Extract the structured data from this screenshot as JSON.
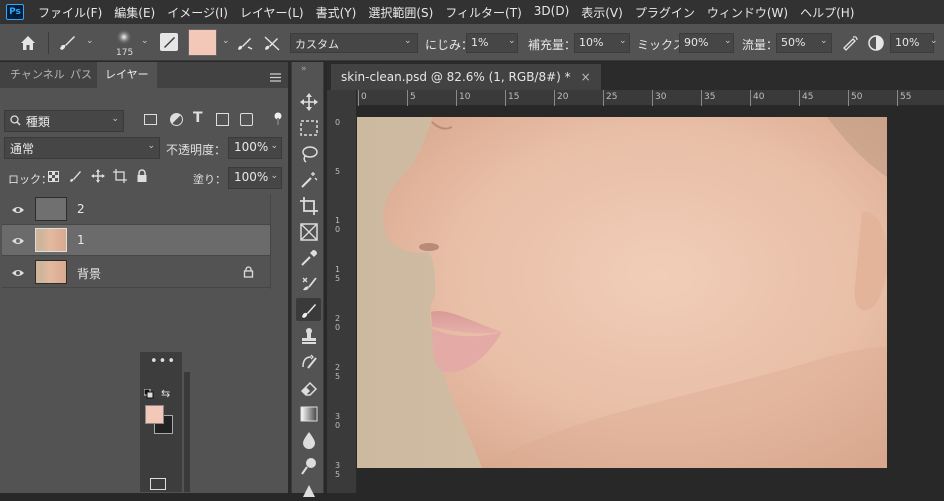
{
  "app": {
    "logo": "Ps"
  },
  "menu": [
    "ファイル(F)",
    "編集(E)",
    "イメージ(I)",
    "レイヤー(L)",
    "書式(Y)",
    "選択範囲(S)",
    "フィルター(T)",
    "3D(D)",
    "表示(V)",
    "プラグイン",
    "ウィンドウ(W)",
    "ヘルプ(H)"
  ],
  "options": {
    "brush_size": "175",
    "mode": "カスタム",
    "wet_label": "にじみ：",
    "wet_value": "1%",
    "load_label": "補充量：",
    "load_value": "10%",
    "mix_label": "ミックス：",
    "mix_value": "90%",
    "flow_label": "流量：",
    "flow_value": "50%",
    "extra_value": "10%",
    "color": "#f3c8b8"
  },
  "panel": {
    "tabs": [
      "チャンネル",
      "パス",
      "レイヤー"
    ],
    "active_tab": "レイヤー",
    "filter_kind": "種類",
    "blend_mode": "通常",
    "opacity_label": "不透明度：",
    "opacity_value": "100%",
    "lock_label": "ロック：",
    "fill_label": "塗り：",
    "fill_value": "100%",
    "layers": [
      {
        "name": "2",
        "thumb": "gray",
        "selected": false,
        "locked": false
      },
      {
        "name": "1",
        "thumb": "face",
        "selected": true,
        "locked": false
      },
      {
        "name": "背景",
        "thumb": "face",
        "selected": false,
        "locked": true
      }
    ]
  },
  "mini_panel": {
    "dots": "•••",
    "fg_color": "#f3c8b8",
    "bg_color": "#222222"
  },
  "document": {
    "tab_title": "skin-clean.psd @ 82.6% (1, RGB/8#) *",
    "close_glyph": "×"
  },
  "ruler": {
    "h_labels": [
      "0",
      "5",
      "10",
      "15",
      "20",
      "25",
      "30",
      "35",
      "40",
      "45",
      "50",
      "55"
    ],
    "v_labels": [
      "0",
      "5",
      "1\n0",
      "1\n5",
      "2\n0",
      "2\n5",
      "3\n0",
      "3\n5"
    ]
  },
  "toolbar_icons": [
    "move-icon",
    "marquee-icon",
    "lasso-icon",
    "magic-wand-icon",
    "crop-icon",
    "frame-icon",
    "eyedropper-icon",
    "healing-icon",
    "mixer-brush-icon",
    "stamp-icon",
    "history-brush-icon",
    "eraser-icon",
    "gradient-icon",
    "blur-icon",
    "dodge-icon",
    "pen-icon"
  ],
  "colors": {
    "accent": "#31a8ff",
    "canvas_bg": "#d8c7b0",
    "skin": "#e9c3ac"
  }
}
